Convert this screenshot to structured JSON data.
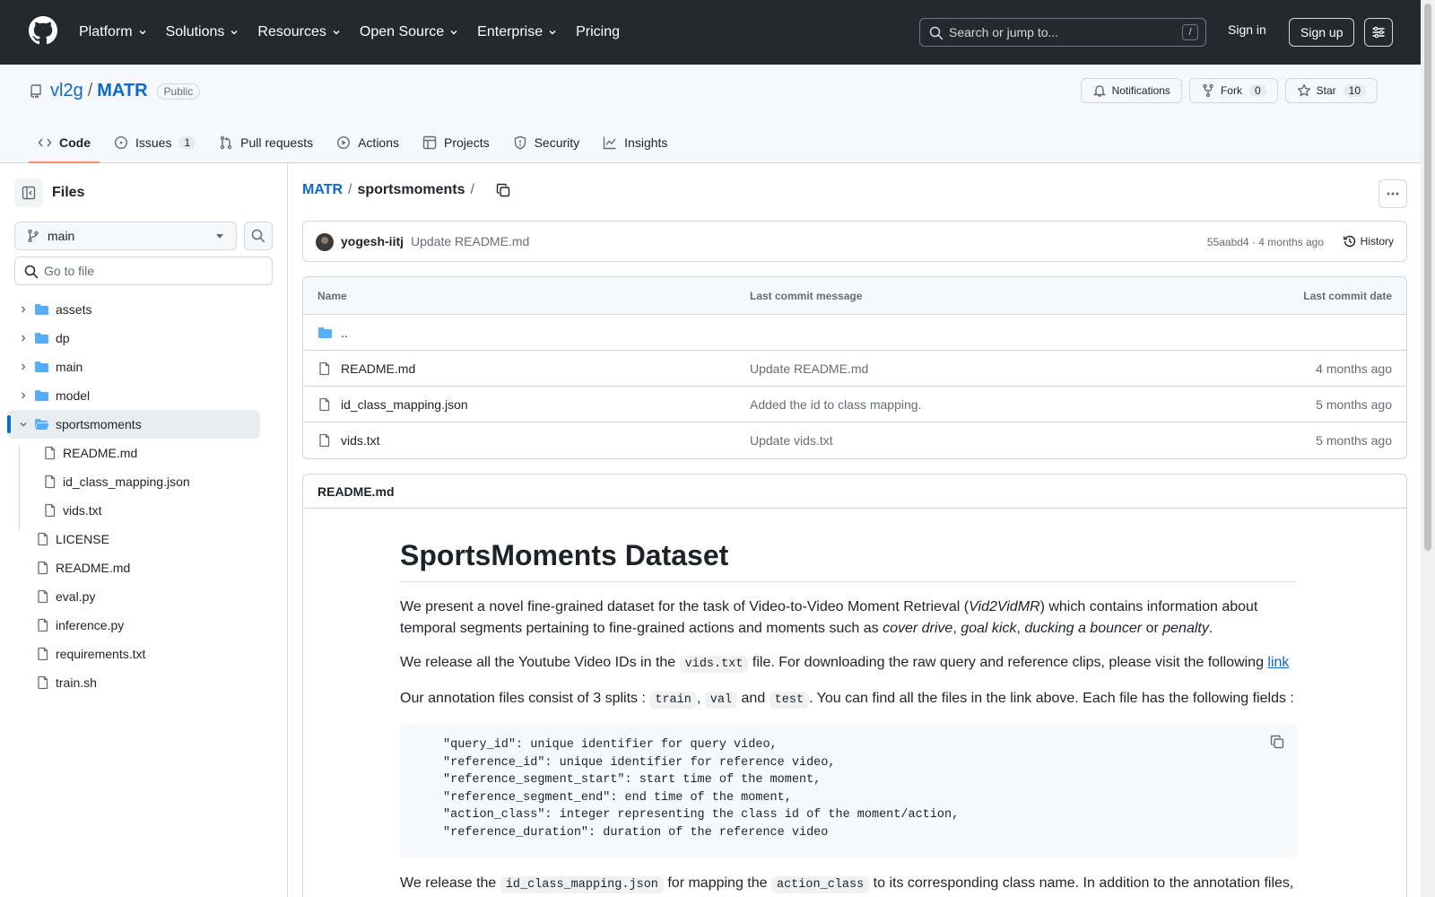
{
  "header": {
    "nav": [
      {
        "label": "Platform",
        "dropdown": true
      },
      {
        "label": "Solutions",
        "dropdown": true
      },
      {
        "label": "Resources",
        "dropdown": true
      },
      {
        "label": "Open Source",
        "dropdown": true
      },
      {
        "label": "Enterprise",
        "dropdown": true
      },
      {
        "label": "Pricing",
        "dropdown": false
      }
    ],
    "search_placeholder": "Search or jump to...",
    "search_shortcut": "/",
    "sign_in": "Sign in",
    "sign_up": "Sign up"
  },
  "repo": {
    "owner": "vl2g",
    "separator": "/",
    "name": "MATR",
    "visibility": "Public",
    "notifications_label": "Notifications",
    "fork_label": "Fork",
    "fork_count": "0",
    "star_label": "Star",
    "star_count": "10",
    "tabs": [
      {
        "label": "Code",
        "icon": "code-icon",
        "active": true,
        "count": ""
      },
      {
        "label": "Issues",
        "icon": "issue-icon",
        "active": false,
        "count": "1"
      },
      {
        "label": "Pull requests",
        "icon": "pull-request-icon",
        "active": false,
        "count": ""
      },
      {
        "label": "Actions",
        "icon": "play-icon",
        "active": false,
        "count": ""
      },
      {
        "label": "Projects",
        "icon": "table-icon",
        "active": false,
        "count": ""
      },
      {
        "label": "Security",
        "icon": "shield-icon",
        "active": false,
        "count": ""
      },
      {
        "label": "Insights",
        "icon": "graph-icon",
        "active": false,
        "count": ""
      }
    ]
  },
  "sidebar": {
    "title": "Files",
    "branch": "main",
    "goto_placeholder": "Go to file",
    "tree": [
      {
        "label": "assets",
        "type": "folder",
        "level": 0,
        "expanded": false,
        "selected": false
      },
      {
        "label": "dp",
        "type": "folder",
        "level": 0,
        "expanded": false,
        "selected": false
      },
      {
        "label": "main",
        "type": "folder",
        "level": 0,
        "expanded": false,
        "selected": false
      },
      {
        "label": "model",
        "type": "folder",
        "level": 0,
        "expanded": false,
        "selected": false
      },
      {
        "label": "sportsmoments",
        "type": "folder",
        "level": 0,
        "expanded": true,
        "selected": true
      },
      {
        "label": "README.md",
        "type": "file",
        "level": 1,
        "selected": false
      },
      {
        "label": "id_class_mapping.json",
        "type": "file",
        "level": 1,
        "selected": false
      },
      {
        "label": "vids.txt",
        "type": "file",
        "level": 1,
        "selected": false
      },
      {
        "label": "LICENSE",
        "type": "file",
        "level": 0,
        "selected": false
      },
      {
        "label": "README.md",
        "type": "file",
        "level": 0,
        "selected": false
      },
      {
        "label": "eval.py",
        "type": "file",
        "level": 0,
        "selected": false
      },
      {
        "label": "inference.py",
        "type": "file",
        "level": 0,
        "selected": false
      },
      {
        "label": "requirements.txt",
        "type": "file",
        "level": 0,
        "selected": false
      },
      {
        "label": "train.sh",
        "type": "file",
        "level": 0,
        "selected": false
      }
    ]
  },
  "breadcrumb": {
    "root": "MATR",
    "sep": "/",
    "current": "sportsmoments",
    "trail": "/"
  },
  "commit": {
    "user": "yogesh-iitj",
    "message": "Update README.md",
    "meta": "55aabd4 · 4 months ago",
    "history_label": "History"
  },
  "files": {
    "headers": {
      "name": "Name",
      "message": "Last commit message",
      "date": "Last commit date"
    },
    "parent": "..",
    "rows": [
      {
        "name": "README.md",
        "message": "Update README.md",
        "date": "4 months ago"
      },
      {
        "name": "id_class_mapping.json",
        "message": "Added the id to class mapping.",
        "date": "5 months ago"
      },
      {
        "name": "vids.txt",
        "message": "Update vids.txt",
        "date": "5 months ago"
      }
    ]
  },
  "readme": {
    "filename": "README.md",
    "title": "SportsMoments Dataset",
    "p1_a": "We present a novel fine-grained dataset for the task of Video-to-Video Moment Retrieval (",
    "p1_em1": "Vid2VidMR",
    "p1_b": ") which contains information about temporal segments pertaining to fine-grained actions and moments such as ",
    "p1_em2": "cover drive",
    "p1_c": ", ",
    "p1_em3": "goal kick",
    "p1_d": ", ",
    "p1_em4": "ducking a bouncer",
    "p1_e": " or ",
    "p1_em5": "penalty",
    "p1_f": ".",
    "p2_a": "We release all the Youtube Video IDs in the ",
    "p2_code": "vids.txt",
    "p2_b": " file. For downloading the raw query and reference clips, please visit the following ",
    "p2_link": "link",
    "p3_a": "Our annotation files consist of 3 splits : ",
    "p3_code1": "train",
    "p3_b": ", ",
    "p3_code2": "val",
    "p3_c": " and ",
    "p3_code3": "test",
    "p3_d": ". You can find all the files in the link above. Each file has the following fields :",
    "code_block": "\"query_id\": unique identifier for query video,\n\"reference_id\": unique identifier for reference video,\n\"reference_segment_start\": start time of the moment,\n\"reference_segment_end\": end time of the moment,\n\"action_class\": integer representing the class id of the moment/action,\n\"reference_duration\": duration of the reference video",
    "p4_a": "We release the ",
    "p4_code1": "id_class_mapping.json",
    "p4_b": " for mapping the ",
    "p4_code2": "action_class",
    "p4_c": " to its corresponding class name. In addition to the annotation files,"
  }
}
